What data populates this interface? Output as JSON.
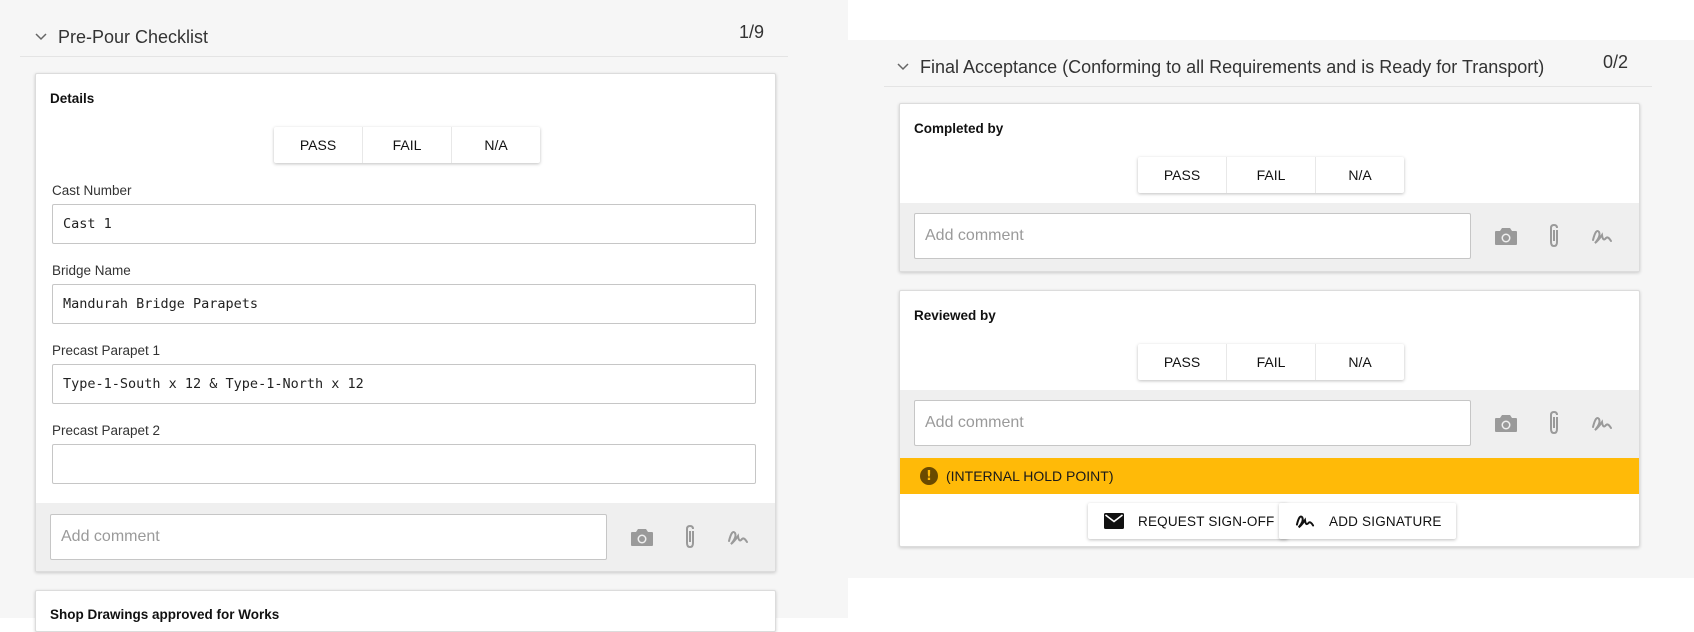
{
  "left_section": {
    "title": "Pre-Pour Checklist",
    "count": "1/9",
    "details_card": {
      "title": "Details",
      "pass": "PASS",
      "fail": "FAIL",
      "na": "N/A",
      "fields": [
        {
          "label": "Cast Number",
          "value": "Cast 1"
        },
        {
          "label": "Bridge Name",
          "value": "Mandurah Bridge Parapets"
        },
        {
          "label": "Precast Parapet 1",
          "value": "Type-1-South x 12 & Type-1-North x 12"
        },
        {
          "label": "Precast Parapet 2",
          "value": ""
        }
      ],
      "comment_placeholder": "Add comment"
    },
    "next_card_title": "Shop Drawings approved for Works"
  },
  "right_section": {
    "title": "Final Acceptance (Conforming to all Requirements and is Ready for Transport)",
    "count": "0/2",
    "completed_card": {
      "title": "Completed by",
      "pass": "PASS",
      "fail": "FAIL",
      "na": "N/A",
      "comment_placeholder": "Add comment"
    },
    "reviewed_card": {
      "title": "Reviewed by",
      "pass": "PASS",
      "fail": "FAIL",
      "na": "N/A",
      "comment_placeholder": "Add comment",
      "hold_point": "(INTERNAL HOLD POINT)",
      "request_signoff": "REQUEST SIGN-OFF",
      "add_signature": "ADD SIGNATURE"
    }
  },
  "icons": [
    "chevron-down-icon",
    "camera-icon",
    "paperclip-icon",
    "signature-icon",
    "warning-icon",
    "mail-icon"
  ],
  "colors": {
    "hold_point": "#ffba08",
    "panel_bg": "#f6f6f6"
  }
}
